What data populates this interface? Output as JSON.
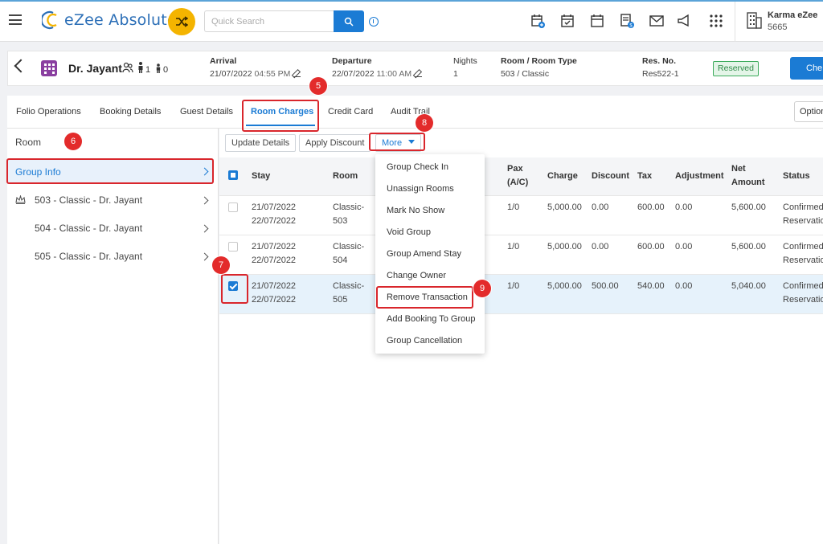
{
  "topbar": {
    "brand": "eZee Absolute",
    "search_placeholder": "Quick Search",
    "hotel_name": "Karma eZee",
    "hotel_id": "5665",
    "icons": [
      "calendar-add-icon",
      "calendar-check-icon",
      "calendar-icon",
      "invoice-icon",
      "mail-icon",
      "announcement-icon",
      "apps-grid-icon"
    ]
  },
  "booking": {
    "guest_name": "Dr. Jayant",
    "adults": "1",
    "children": "0",
    "arrival_label": "Arrival",
    "arrival_date": "21/07/2022",
    "arrival_time": "04:55 PM",
    "departure_label": "Departure",
    "departure_date": "22/07/2022",
    "departure_time": "11:00 AM",
    "nights_label": "Nights",
    "nights": "1",
    "room_type_label": "Room / Room Type",
    "room_type": "503 / Classic",
    "res_no_label": "Res. No.",
    "res_no": "Res522-1",
    "status": "Reserved",
    "action_button": "Che"
  },
  "tabs": [
    "Folio Operations",
    "Booking Details",
    "Guest Details",
    "Room Charges",
    "Credit Card",
    "Audit Trail"
  ],
  "active_tab": "Room Charges",
  "options_button": "Option",
  "sidebar": {
    "title": "Room",
    "group_info": "Group Info",
    "rooms": [
      "503 - Classic - Dr. Jayant",
      "504 - Classic - Dr. Jayant",
      "505 - Classic - Dr. Jayant"
    ]
  },
  "toolbar": {
    "update_details": "Update Details",
    "apply_discount": "Apply Discount",
    "more": "More"
  },
  "table": {
    "headers": {
      "stay": "Stay",
      "room": "Room",
      "pax_1": "Pax",
      "pax_2": "(A/C)",
      "charge": "Charge",
      "discount": "Discount",
      "tax": "Tax",
      "adjustment": "Adjustment",
      "net_1": "Net",
      "net_2": "Amount",
      "status": "Status"
    },
    "rows": [
      {
        "stay_from": "21/07/2022",
        "stay_to": "22/07/2022",
        "room_1": "Classic-",
        "room_2": "503",
        "pax": "1/0",
        "charge": "5,000.00",
        "discount": "0.00",
        "tax": "600.00",
        "adjustment": "0.00",
        "net": "5,600.00",
        "status_1": "Confirmed",
        "status_2": "Reservation",
        "checked": false
      },
      {
        "stay_from": "21/07/2022",
        "stay_to": "22/07/2022",
        "room_1": "Classic-",
        "room_2": "504",
        "pax": "1/0",
        "charge": "5,000.00",
        "discount": "0.00",
        "tax": "600.00",
        "adjustment": "0.00",
        "net": "5,600.00",
        "status_1": "Confirmed",
        "status_2": "Reservation",
        "checked": false
      },
      {
        "stay_from": "21/07/2022",
        "stay_to": "22/07/2022",
        "room_1": "Classic-",
        "room_2": "505",
        "pax": "1/0",
        "charge": "5,000.00",
        "discount": "500.00",
        "tax": "540.00",
        "adjustment": "0.00",
        "net": "5,040.00",
        "status_1": "Confirmed",
        "status_2": "Reservation",
        "checked": true
      }
    ]
  },
  "more_menu": [
    "Group Check In",
    "Unassign Rooms",
    "Mark No Show",
    "Void Group",
    "Group Amend Stay",
    "Change Owner",
    "Remove Transaction",
    "Add Booking To Group",
    "Group Cancellation"
  ],
  "callouts": [
    "5",
    "6",
    "7",
    "8",
    "9"
  ],
  "colors": {
    "accent": "#1b7bd4",
    "highlight": "#d9262c",
    "badge": "#e32b2b",
    "reserved_green": "#2e8b47",
    "shuffle_yellow": "#f4b400",
    "guest_icon_purple": "#8a3fa0"
  }
}
